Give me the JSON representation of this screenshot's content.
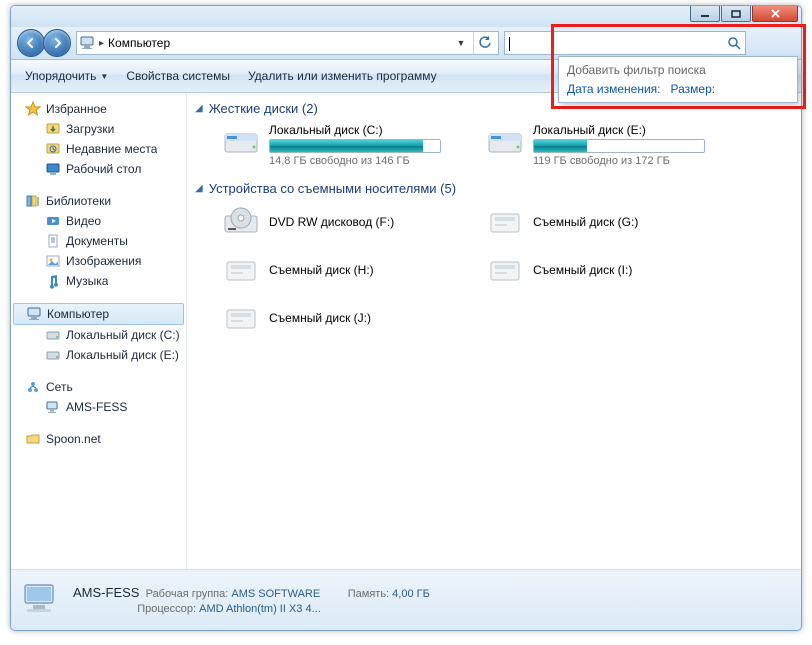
{
  "window": {
    "address": "Компьютер"
  },
  "search": {
    "placeholder": "",
    "filter_title": "Добавить фильтр поиска",
    "filter_links": [
      "Дата изменения:",
      "Размер:"
    ]
  },
  "toolbar": {
    "organize": "Упорядочить",
    "properties": "Свойства системы",
    "change_program": "Удалить или изменить программу"
  },
  "sidebar": {
    "groups": [
      {
        "label": "Избранное",
        "icon": "star",
        "children": [
          {
            "label": "Загрузки",
            "icon": "downloads"
          },
          {
            "label": "Недавние места",
            "icon": "recent"
          },
          {
            "label": "Рабочий стол",
            "icon": "desktop"
          }
        ]
      },
      {
        "label": "Библиотеки",
        "icon": "libraries",
        "children": [
          {
            "label": "Видео",
            "icon": "video"
          },
          {
            "label": "Документы",
            "icon": "document"
          },
          {
            "label": "Изображения",
            "icon": "image"
          },
          {
            "label": "Музыка",
            "icon": "music"
          }
        ]
      },
      {
        "label": "Компьютер",
        "icon": "computer",
        "selected": true,
        "children": [
          {
            "label": "Локальный диск (C:)",
            "icon": "hdd"
          },
          {
            "label": "Локальный диск (E:)",
            "icon": "hdd"
          }
        ]
      },
      {
        "label": "Сеть",
        "icon": "network",
        "children": [
          {
            "label": "AMS-FESS",
            "icon": "pc"
          }
        ]
      },
      {
        "label": "Spoon.net",
        "icon": "folder"
      }
    ]
  },
  "sections": {
    "hdd": {
      "title": "Жесткие диски (2)"
    },
    "removable": {
      "title": "Устройства со съемными носителями (5)"
    }
  },
  "drives": {
    "hdd": [
      {
        "name": "Локальный диск (C:)",
        "free": "14,8 ГБ свободно из 146 ГБ",
        "fill_pct": 90
      },
      {
        "name": "Локальный диск (E:)",
        "free": "119 ГБ свободно из 172 ГБ",
        "fill_pct": 31
      }
    ],
    "removable": [
      {
        "name": "DVD RW дисковод (F:)",
        "icon": "dvd"
      },
      {
        "name": "Съемный диск (G:)",
        "icon": "removable"
      },
      {
        "name": "Съемный диск (H:)",
        "icon": "removable"
      },
      {
        "name": "Съемный диск (I:)",
        "icon": "removable"
      },
      {
        "name": "Съемный диск (J:)",
        "icon": "removable"
      }
    ]
  },
  "details": {
    "name": "AMS-FESS",
    "workgroup_label": "Рабочая группа:",
    "workgroup_value": "AMS SOFTWARE",
    "memory_label": "Память:",
    "memory_value": "4,00 ГБ",
    "cpu_label": "Процессор:",
    "cpu_value": "AMD Athlon(tm) II X3 4..."
  }
}
